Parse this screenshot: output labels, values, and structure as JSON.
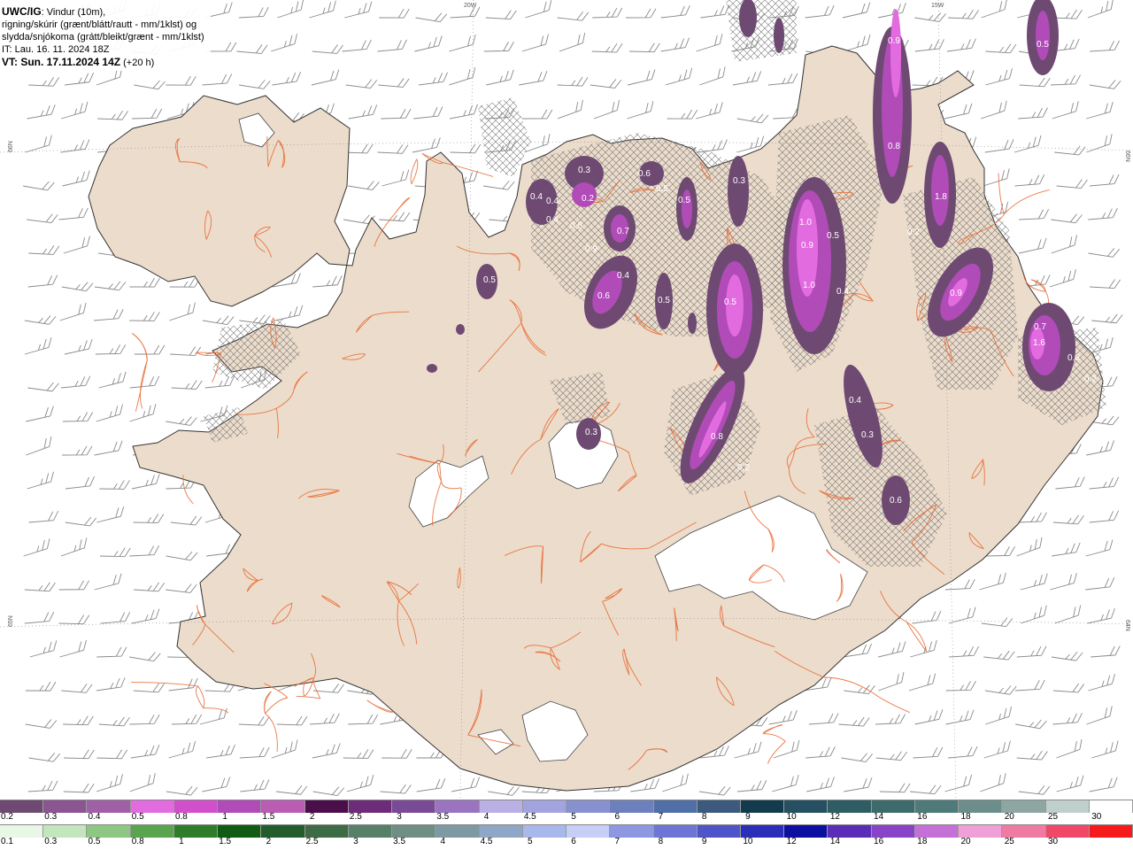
{
  "header": {
    "product": "UWC/IG",
    "line1": ": Vindur (10m),",
    "line2": "rigning/skúrir (grænt/blátt/rautt - mm/1klst) og",
    "line3": "slydda/snjókoma (grátt/bleikt/grænt - mm/1klst)",
    "line4": "IT: Lau. 16. 11. 2024 18Z",
    "line5": "VT: Sun. 17.11.2024 14Z",
    "line5_suffix": " (+20 h)"
  },
  "coords": {
    "top_lon1": "20W",
    "top_lon2": "15W",
    "left_lat1": "66N",
    "left_lat2": "65N",
    "right_lat1": "66N",
    "right_lat2": "64N"
  },
  "colors": {
    "land": "#ecdccb",
    "sea": "#ffffff",
    "roads": "#e86a33",
    "coast": "#333333",
    "glacier": "#ffffff"
  },
  "snow_legend": {
    "colors": [
      "#6e4a72",
      "#8a5590",
      "#a060a6",
      "#e36be0",
      "#d24fcc",
      "#b04bb8",
      "#b95cb2",
      "#4a0f4a",
      "#6d2b7a",
      "#7b4a97",
      "#9a74c0",
      "#bbb0e3",
      "#a3a4df",
      "#8891d0",
      "#6d80bd",
      "#4f6fa6",
      "#3b5a7e",
      "#123c4d",
      "#245061",
      "#2e5d63",
      "#3d6a6a",
      "#4f7a7a",
      "#6b8e8a",
      "#8ea6a2",
      "#bfd0cc",
      "#ffffff"
    ],
    "labels": [
      "0.2",
      "0.3",
      "0.4",
      "0.5",
      "0.8",
      "1",
      "1.5",
      "2",
      "2.5",
      "3",
      "3.5",
      "4",
      "4.5",
      "5",
      "6",
      "7",
      "8",
      "9",
      "10",
      "12",
      "14",
      "16",
      "18",
      "20",
      "25",
      "30"
    ]
  },
  "rain_legend": {
    "colors": [
      "#e8f7e6",
      "#c4e6bd",
      "#8ec782",
      "#5aa34f",
      "#2e7d2a",
      "#0f5c12",
      "#245d2c",
      "#3c6b45",
      "#57806a",
      "#6e8f82",
      "#7d99a1",
      "#8fa6c7",
      "#a9b8ea",
      "#c6cff6",
      "#8e97e2",
      "#6e75d6",
      "#4f55c9",
      "#2b2fb8",
      "#0c0fa0",
      "#5a2db7",
      "#8a42c8",
      "#c470d6",
      "#f0a0d7",
      "#f07aa4",
      "#f04868",
      "#f51b1b"
    ],
    "labels": [
      "0.1",
      "0.3",
      "0.5",
      "0.8",
      "1",
      "1.5",
      "2",
      "2.5",
      "3",
      "3.5",
      "4",
      "4.5",
      "5",
      "6",
      "7",
      "8",
      "9",
      "10",
      "12",
      "14",
      "16",
      "18",
      "20",
      "25",
      "30"
    ]
  },
  "precip_labels": [
    "0.5",
    "0.9",
    "0.3",
    "0.5",
    "0.4",
    "0.4",
    "0.2",
    "0.5",
    "0.7",
    "0.9",
    "0.4",
    "0.6",
    "0.6",
    "0.5",
    "0.5",
    "0.3",
    "0.3",
    "0.5",
    "0.5",
    "0.8",
    "0.2",
    "1.0",
    "0.9",
    "0.5",
    "1.0",
    "0.4",
    "0.8",
    "1.8",
    "0.2",
    "0.9",
    "0.7",
    "1.6",
    "0.3",
    "0.2",
    "0.4",
    "0.3",
    "0.6",
    "0.3",
    "0.5"
  ]
}
